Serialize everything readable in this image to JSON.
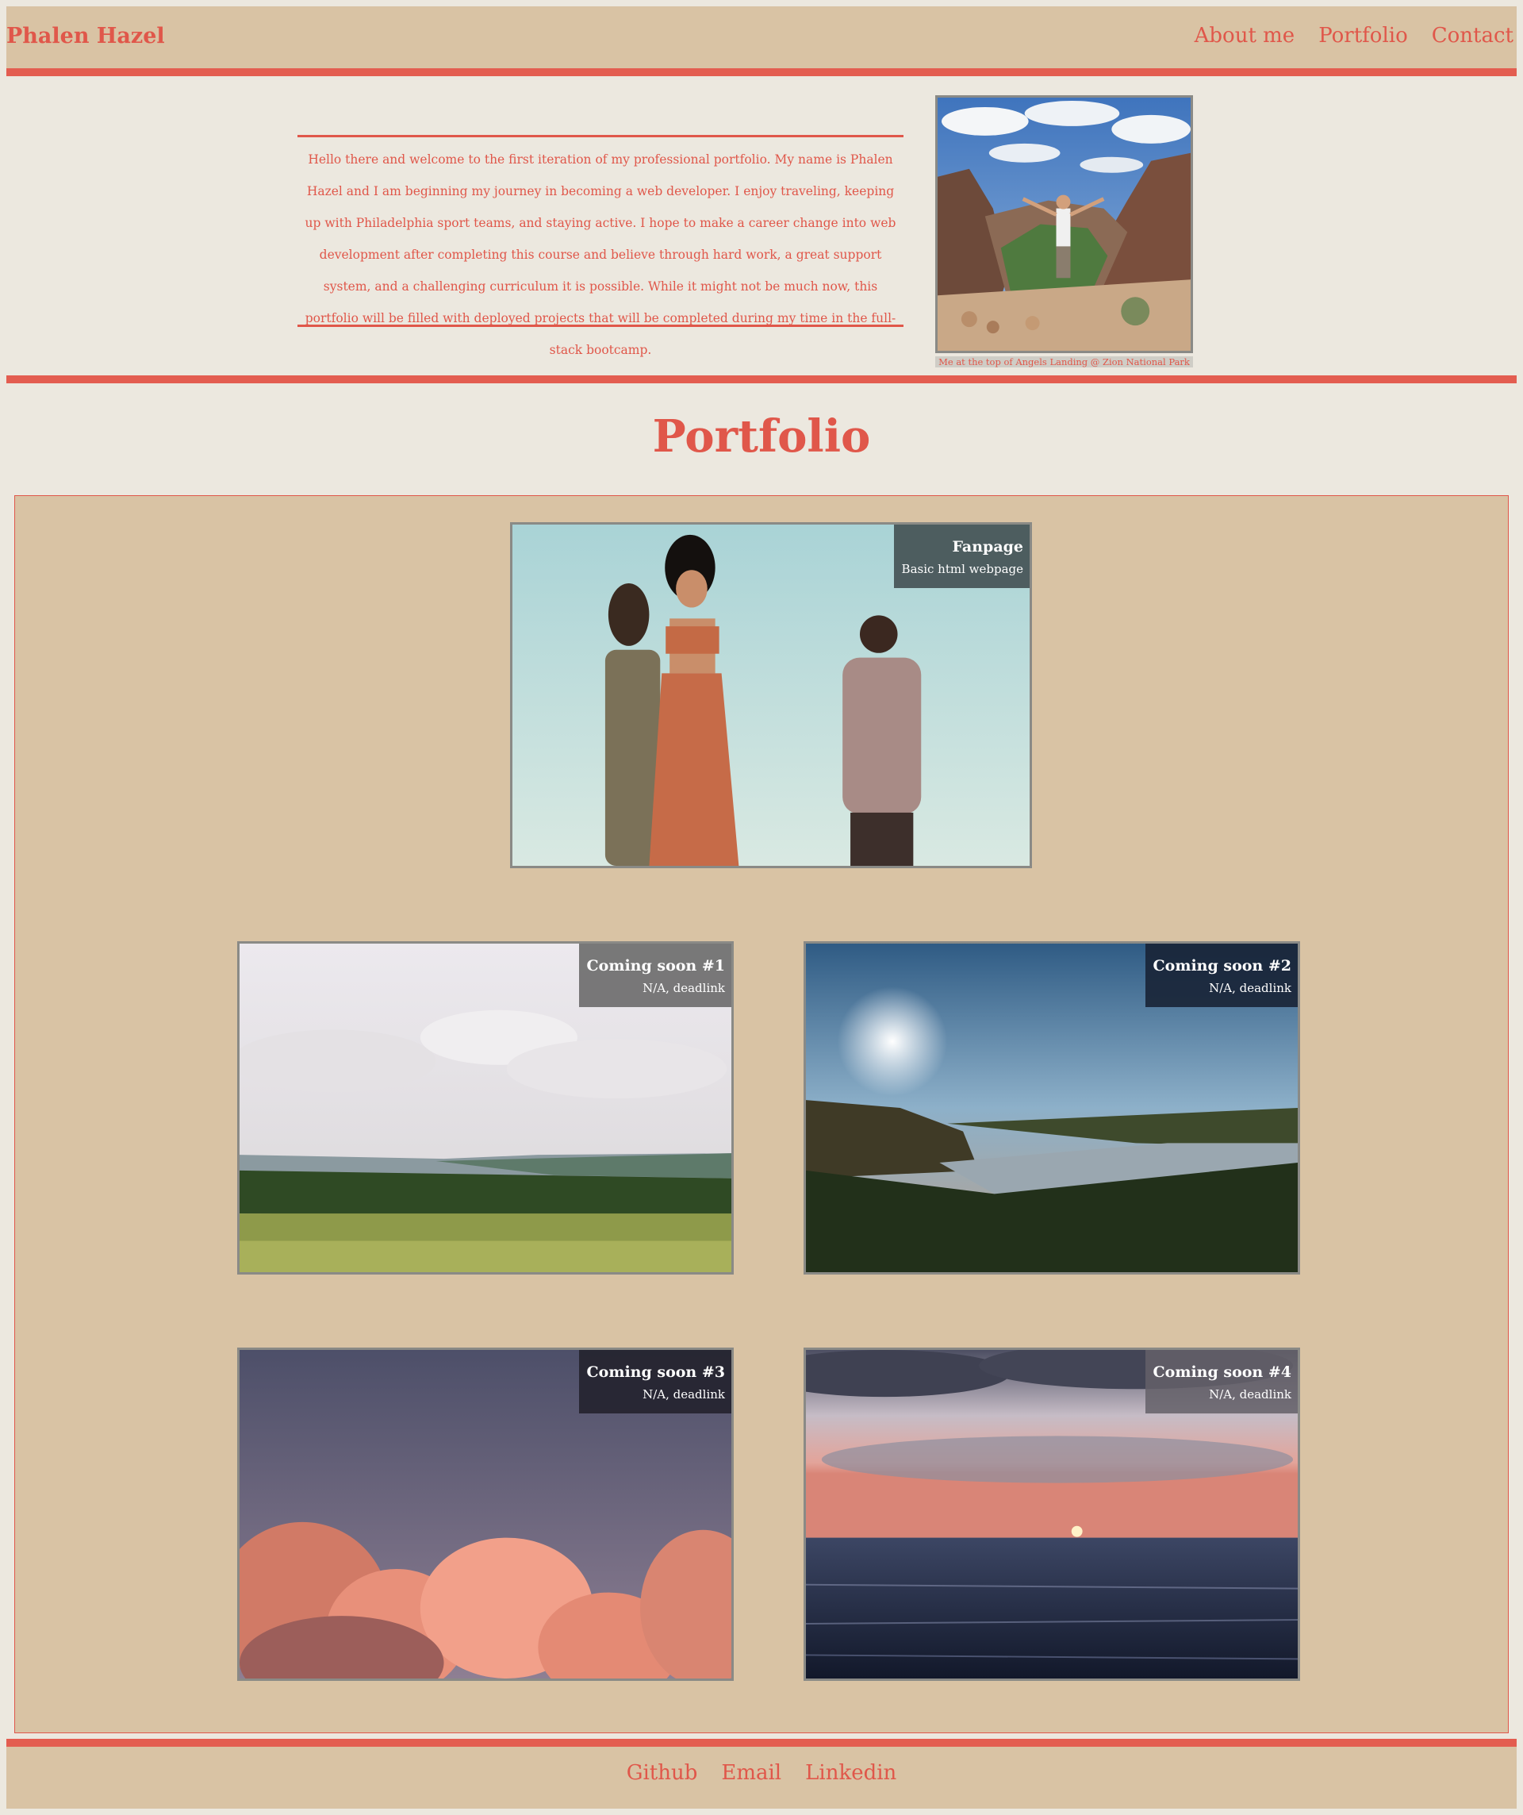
{
  "header": {
    "brand": "Phalen Hazel",
    "nav": [
      "About me",
      "Portfolio",
      "Contact"
    ]
  },
  "about": {
    "bio": "Hello there and welcome to the first iteration of my professional portfolio. My name is Phalen Hazel and I am beginning my journey in becoming a web developer. I enjoy traveling, keeping up with Philadelphia sport teams, and staying active. I hope to make a career change into web development after completing this course and believe through hard work, a great support system, and a challenging curriculum it is possible. While it might not be much now, this portfolio will be filled with deployed projects that will be completed during my time in the full-stack bootcamp.",
    "photo_caption": "Me at the top of Angels Landing @ Zion National Park"
  },
  "portfolio": {
    "title": "Portfolio",
    "projects": [
      {
        "title": "Fanpage",
        "subtitle": "Basic html webpage"
      },
      {
        "title": "Coming soon #1",
        "subtitle": "N/A, deadlink"
      },
      {
        "title": "Coming soon #2",
        "subtitle": "N/A, deadlink"
      },
      {
        "title": "Coming soon #3",
        "subtitle": "N/A, deadlink"
      },
      {
        "title": "Coming soon #4",
        "subtitle": "N/A, deadlink"
      }
    ]
  },
  "footer": {
    "links": [
      "Github",
      "Email",
      "Linkedin"
    ]
  },
  "colors": {
    "accent": "#e35d50",
    "text": "#e0574a",
    "tan": "#d9c3a4",
    "page_bg": "#ece8df"
  }
}
